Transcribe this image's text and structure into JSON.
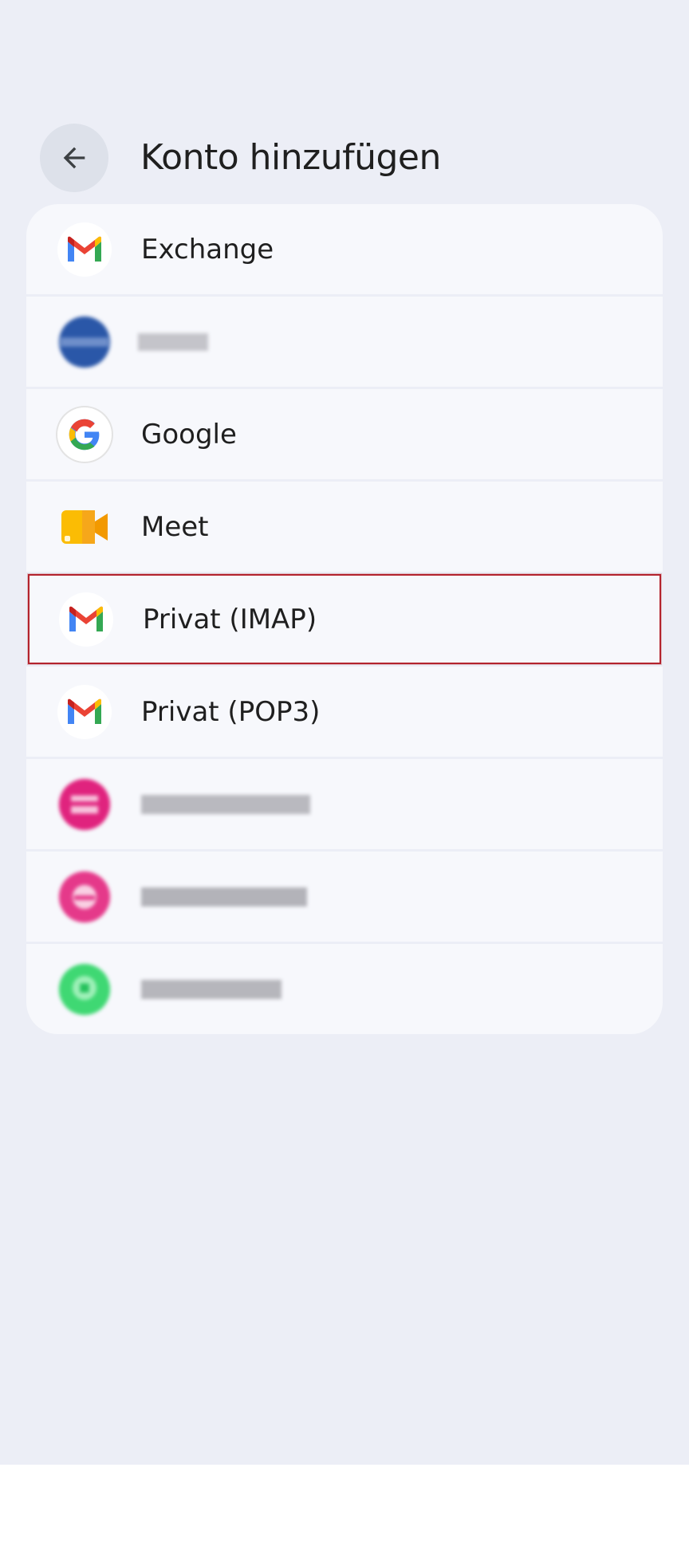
{
  "header": {
    "title": "Konto hinzufügen"
  },
  "accounts": [
    {
      "label": "Exchange",
      "icon": "gmail-icon",
      "blurred": false
    },
    {
      "label": "",
      "icon": "blurred-blue-icon",
      "blurred": true
    },
    {
      "label": "Google",
      "icon": "google-icon",
      "blurred": false
    },
    {
      "label": "Meet",
      "icon": "meet-icon",
      "blurred": false
    },
    {
      "label": "Privat (IMAP)",
      "icon": "gmail-icon",
      "blurred": false,
      "selected": true
    },
    {
      "label": "Privat (POP3)",
      "icon": "gmail-icon",
      "blurred": false
    },
    {
      "label": "",
      "icon": "blurred-pink-mail-icon",
      "blurred": true
    },
    {
      "label": "",
      "icon": "blurred-pink-mail-icon",
      "blurred": true
    },
    {
      "label": "",
      "icon": "blurred-green-icon",
      "blurred": true
    }
  ],
  "colors": {
    "background": "#eceef6",
    "item_bg": "#f7f8fc",
    "selection_border": "#b3232d"
  }
}
